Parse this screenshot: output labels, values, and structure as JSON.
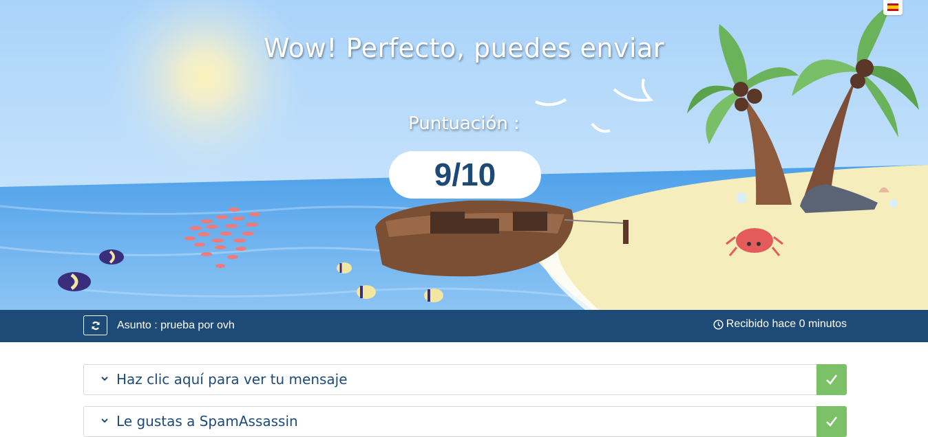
{
  "hero": {
    "title": "Wow! Perfecto, puedes enviar",
    "score_label": "Puntuación :",
    "score": "9/10"
  },
  "language": {
    "icon": "spain-flag-icon",
    "code": "es"
  },
  "infobar": {
    "subject": "Asunto : prueba por ovh",
    "received": "Recibido hace 0 minutos",
    "refresh_icon": "refresh-icon",
    "clock_icon": "clock-icon"
  },
  "panels": [
    {
      "title": "Haz clic aquí para ver tu mensaje",
      "status": "passed"
    },
    {
      "title": "Le gustas a SpamAssassin",
      "status": "passed"
    }
  ],
  "colors": {
    "primary": "#1d4a76",
    "success": "#7cc067",
    "sky": "#a9d2f8",
    "sea": "#5fa9ec",
    "sand": "#f5eebc"
  }
}
